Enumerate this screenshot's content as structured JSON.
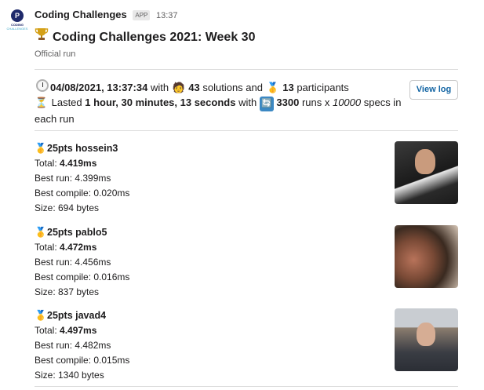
{
  "message": {
    "app_avatar": {
      "logo_letter": "P",
      "logo_text": "CODING",
      "logo_subtext": "CHALLENGES"
    },
    "sender": "Coding Challenges",
    "badge": "APP",
    "time": "13:37",
    "title_icon": "trophy-icon",
    "title": "Coding Challenges 2021: Week 30",
    "subtitle": "Official run"
  },
  "summary": {
    "datetime": "04/08/2021, 13:37:34",
    "with_1": " with ",
    "solutions_count": "43",
    "solutions_text": " solutions and ",
    "participants_count": "13",
    "participants_text": " participants",
    "lasted_prefix": " Lasted ",
    "duration": "1 hour, 30 minutes, 13 seconds",
    "with_2": " with ",
    "runs": "3300",
    "runs_text": " runs x ",
    "specs": "10000",
    "specs_text": " specs in each run"
  },
  "view_log_label": "View log",
  "entries": [
    {
      "points_name": "25pts hossein3",
      "total_label": "Total: ",
      "total": "4.419ms",
      "best_run": "Best run: 4.399ms",
      "best_compile": "Best compile: 0.020ms",
      "size": "Size: 694 bytes"
    },
    {
      "points_name": "25pts pablo5",
      "total_label": "Total: ",
      "total": "4.472ms",
      "best_run": "Best run: 4.456ms",
      "best_compile": "Best compile: 0.016ms",
      "size": "Size: 837 bytes"
    },
    {
      "points_name": "25pts javad4",
      "total_label": "Total: ",
      "total": "4.497ms",
      "best_run": "Best run: 4.482ms",
      "best_compile": "Best compile: 0.015ms",
      "size": "Size: 1340 bytes"
    }
  ],
  "icons": {
    "clock": "hourglass-clock-icon",
    "solutions": "technologist-icon",
    "participants": "medal-icon",
    "runs": "repeat-icon",
    "entry_medal": "medal-icon"
  },
  "colors": {
    "link": "#1264a3",
    "muted": "#616061"
  }
}
